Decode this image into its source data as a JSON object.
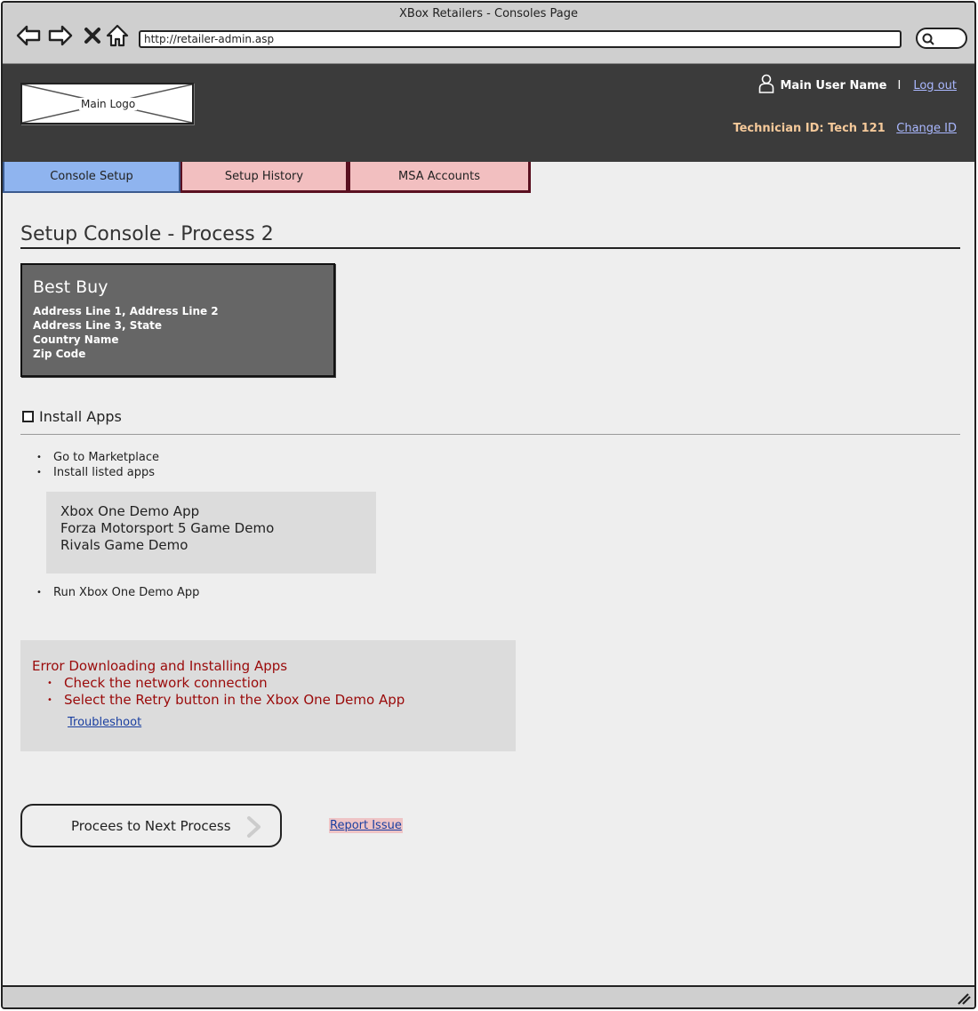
{
  "window": {
    "title": "XBox Retailers - Consoles Page"
  },
  "browser": {
    "url": "http://retailer-admin.asp"
  },
  "header": {
    "logo_label": "Main Logo",
    "user_name": "Main User Name",
    "separator": "I",
    "logout_label": "Log out",
    "technician_text": "Technician ID: Tech 121",
    "change_id_label": "Change ID"
  },
  "tabs": [
    {
      "label": "Console Setup",
      "active": true
    },
    {
      "label": "Setup History",
      "active": false
    },
    {
      "label": "MSA Accounts",
      "active": false
    }
  ],
  "main": {
    "title": "Setup Console - Process 2",
    "store": {
      "name": "Best Buy",
      "lines": [
        "Address Line 1, Address Line 2",
        "Address Line 3, State",
        "Country Name",
        "Zip Code"
      ]
    },
    "section": {
      "label": "Install Apps",
      "steps_a": [
        "Go to Marketplace",
        "Install listed apps"
      ],
      "apps": [
        "Xbox One Demo App",
        "Forza Motorsport 5 Game Demo",
        "Rivals Game Demo"
      ],
      "steps_b": [
        "Run Xbox One Demo App"
      ]
    },
    "error": {
      "title": "Error Downloading and Installing Apps",
      "items": [
        "Check the network connection",
        "Select the Retry button in the Xbox One Demo App"
      ],
      "link": "Troubleshoot"
    },
    "proceed_label": "Procees to Next Process",
    "report_label": "Report Issue"
  },
  "colors": {
    "active_tab": "#8fb4ef",
    "inactive_tab": "#f2bfc0",
    "header_bg": "#3b3b3b",
    "error_text": "#9a0a0a",
    "link": "#1a3fa0"
  }
}
